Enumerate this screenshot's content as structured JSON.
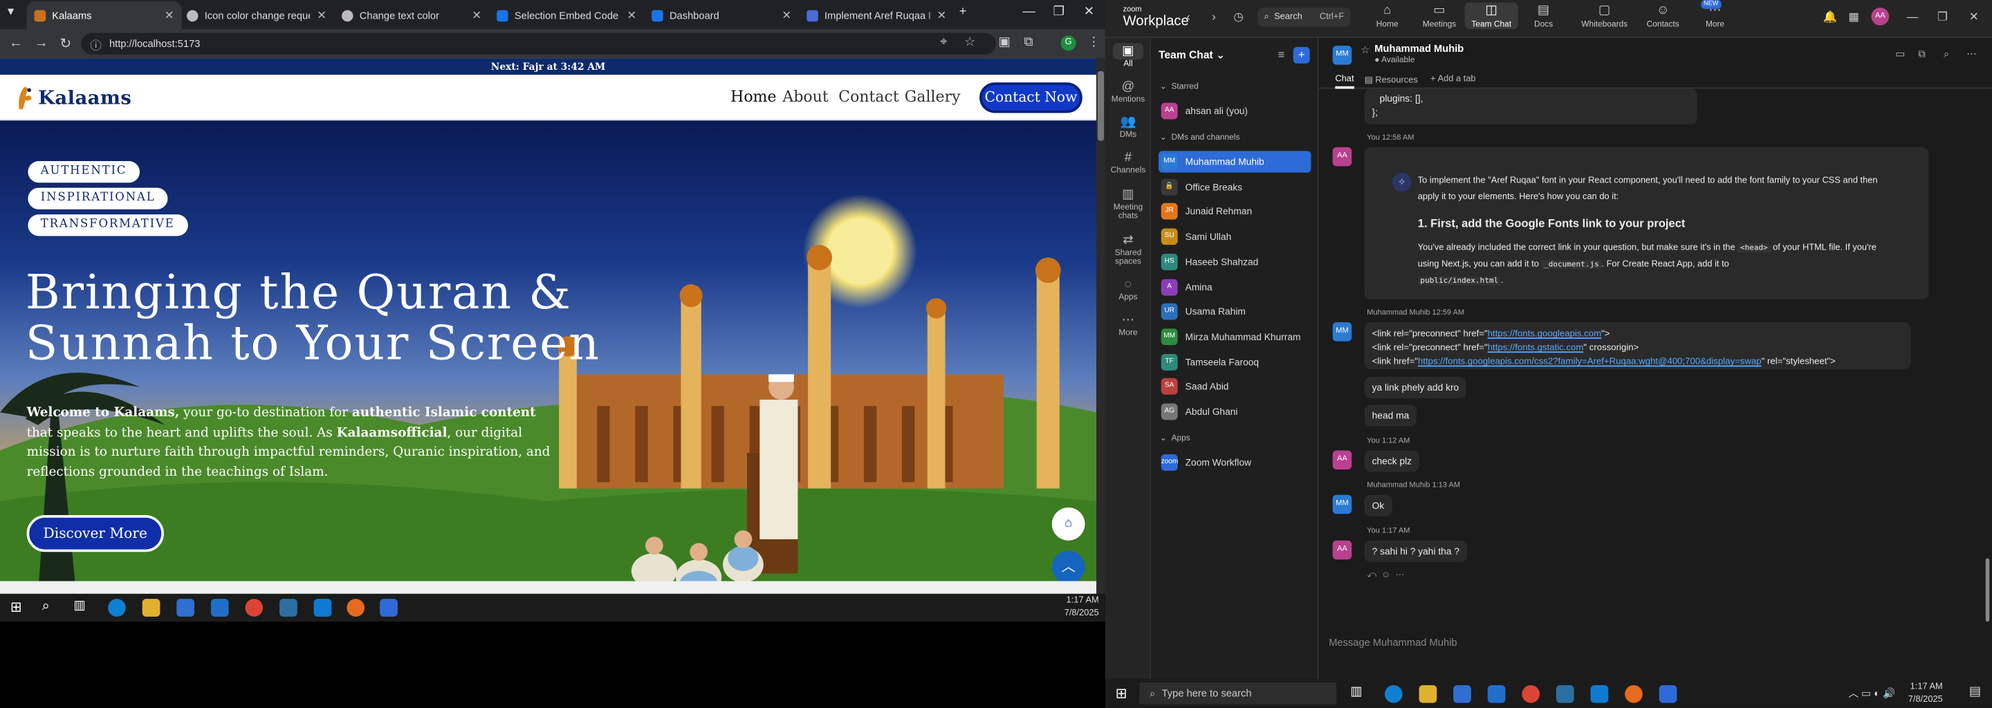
{
  "browser": {
    "tabs": [
      {
        "label": "Kalaams",
        "color": "#c9731a",
        "active": true
      },
      {
        "label": "Icon color change request",
        "color": "#bbbbbb"
      },
      {
        "label": "Change text color",
        "color": "#bbbbbb"
      },
      {
        "label": "Selection Embed Code - Go",
        "color": "#1a73e8"
      },
      {
        "label": "Dashboard",
        "color": "#1a73e8"
      },
      {
        "label": "Implement Aref Ruqaa Font",
        "color": "#4b6bd9"
      }
    ],
    "url": "http://localhost:5173",
    "profile_letter": "G"
  },
  "site": {
    "prayer_banner": "Next: Fajr at 3:42 AM",
    "logo_text": "Kalaams",
    "nav": [
      "Home",
      "About",
      "Contact",
      "Gallery"
    ],
    "contact_button": "Contact Now",
    "badges": [
      "AUTHENTIC",
      "INSPIRATIONAL",
      "TRANSFORMATIVE"
    ],
    "headline_1": "Bringing the Quran &",
    "headline_2": "Sunnah to Your Screen",
    "para_1_bold": "Welcome to Kalaams,",
    "para_1": " your go-to destination for ",
    "para_2_bold": "authentic Islamic content",
    "para_2": " that speaks to the heart and uplifts the soul. As ",
    "para_3_bold": "Kalaamsofficial",
    "para_3": ", our digital mission is to nurture faith through impactful reminders, Quranic inspiration, and reflections grounded in the teachings of Islam.",
    "discover_button": "Discover More"
  },
  "taskbar_left": {
    "time": "1:17 AM",
    "date": "7/8/2025"
  },
  "zoom": {
    "brand_top": "zoom",
    "brand": "Workplace",
    "search": "Search",
    "search_shortcut": "Ctrl+F",
    "topnav": [
      "Home",
      "Meetings",
      "Team Chat",
      "Docs",
      "Whiteboards",
      "Contacts",
      "More"
    ],
    "new_badge": "NEW",
    "avatar": "AA",
    "rail": [
      "All",
      "Mentions",
      "DMs",
      "Channels",
      "Meeting chats",
      "Shared spaces",
      "Apps",
      "More"
    ],
    "panel_title": "Team Chat",
    "sections": {
      "starred": "Starred",
      "dms": "DMs and channels",
      "apps": "Apps"
    },
    "starred": [
      {
        "name": "ahsan ali (you)",
        "init": "AA",
        "color": "#b9418f"
      }
    ],
    "contacts": [
      {
        "name": "Muhammad Muhib",
        "init": "MM",
        "color": "#2b7bd4",
        "active": true
      },
      {
        "name": "Office Breaks",
        "init": "🔒",
        "color": "#3a3a3a"
      },
      {
        "name": "Junaid Rehman",
        "init": "JR",
        "color": "#e4771b"
      },
      {
        "name": "Sami Ullah",
        "init": "SU",
        "color": "#c98c1a"
      },
      {
        "name": "Haseeb Shahzad",
        "init": "HS",
        "color": "#2f8a7b"
      },
      {
        "name": "Amina",
        "init": "A",
        "color": "#8a3fb9"
      },
      {
        "name": "Usama Rahim",
        "init": "UR",
        "color": "#2b6fb9"
      },
      {
        "name": "Mirza Muhammad Khurram",
        "init": "MM",
        "color": "#2f8a3f"
      },
      {
        "name": "Tamseela Farooq",
        "init": "TF",
        "color": "#2f8a7b"
      },
      {
        "name": "Saad Abid",
        "init": "SA",
        "color": "#b94141"
      },
      {
        "name": "Abdul Ghani",
        "init": "AG",
        "color": "#777777"
      }
    ],
    "apps": [
      {
        "name": "Zoom Workflow",
        "init": "zoom",
        "color": "#2d6bd9"
      }
    ],
    "chat": {
      "name": "Muhammad Muhib",
      "status": "Available",
      "tabs": [
        "Chat",
        "Resources",
        "Add a tab"
      ],
      "code_tail_1": "plugins: [],",
      "code_tail_2": "};",
      "m1_meta": "You 12:58 AM",
      "m1_intro": "To implement the \"Aref Ruqaa\" font in your React component, you'll need to add the font family to your CSS and then apply it to your elements. Here's how you can do it:",
      "m1_heading": "1. First, add the Google Fonts link to your project",
      "m1_body_a": "You've already included the correct link in your question, but make sure it's in the ",
      "m1_code1": "<head>",
      "m1_body_b": " of your HTML file. If you're using Next.js, you can add it to ",
      "m1_code2": "_document.js",
      "m1_body_c": ". For Create React App, add it to",
      "m1_code3": "public/index.html",
      "m2_meta": "Muhammad Muhib 12:59 AM",
      "m2_l1a": "<link rel=\"preconnect\" href=\"",
      "m2_l1b": "https://fonts.googleapis.com",
      "m2_l1c": "\">",
      "m2_l2a": "<link rel=\"preconnect\" href=\"",
      "m2_l2b": "https://fonts.gstatic.com",
      "m2_l2c": "\" crossorigin>",
      "m2_l3a": "<link href=\"",
      "m2_l3b": "https://fonts.googleapis.com/css2?family=Aref+Ruqaa:wght@400;700&display=swap",
      "m2_l3c": "\" rel=\"stylesheet\">",
      "m2_b2": "ya link phely add kro",
      "m2_b3": "head ma",
      "m3_meta": "You 1:12 AM",
      "m3_b1": "check plz",
      "m4_meta": "Muhammad Muhib 1:13 AM",
      "m4_b1": "Ok",
      "m5_meta": "You 1:17 AM",
      "m5_b1": "? sahi hi ? yahi tha ?",
      "compose_placeholder": "Message Muhammad Muhib"
    }
  },
  "taskbar_right": {
    "search": "Type here to search",
    "time": "1:17 AM",
    "date": "7/8/2025"
  }
}
